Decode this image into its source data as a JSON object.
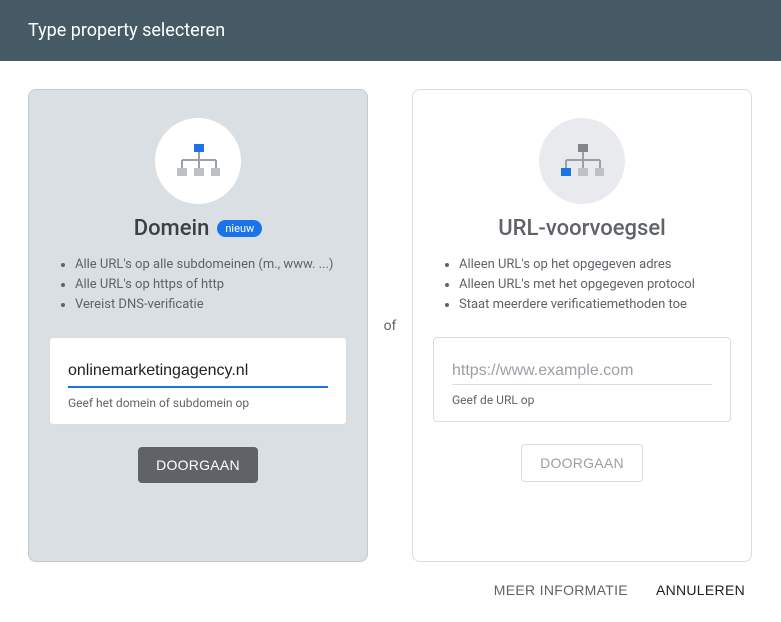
{
  "header": {
    "title": "Type property selecteren"
  },
  "separator": "of",
  "domain_card": {
    "title": "Domein",
    "badge": "nieuw",
    "bullets": [
      "Alle URL's op alle subdomeinen (m., www. ...)",
      "Alle URL's op https of http",
      "Vereist DNS-verificatie"
    ],
    "input_value": "onlinemarketingagency.nl",
    "helper": "Geef het domein of subdomein op",
    "button": "DOORGAAN"
  },
  "url_card": {
    "title": "URL-voorvoegsel",
    "bullets": [
      "Alleen URL's op het opgegeven adres",
      "Alleen URL's met het opgegeven protocol",
      "Staat meerdere verificatiemethoden toe"
    ],
    "placeholder": "https://www.example.com",
    "helper": "Geef de URL op",
    "button": "DOORGAAN"
  },
  "footer": {
    "more_info": "MEER INFORMATIE",
    "cancel": "ANNULEREN"
  }
}
